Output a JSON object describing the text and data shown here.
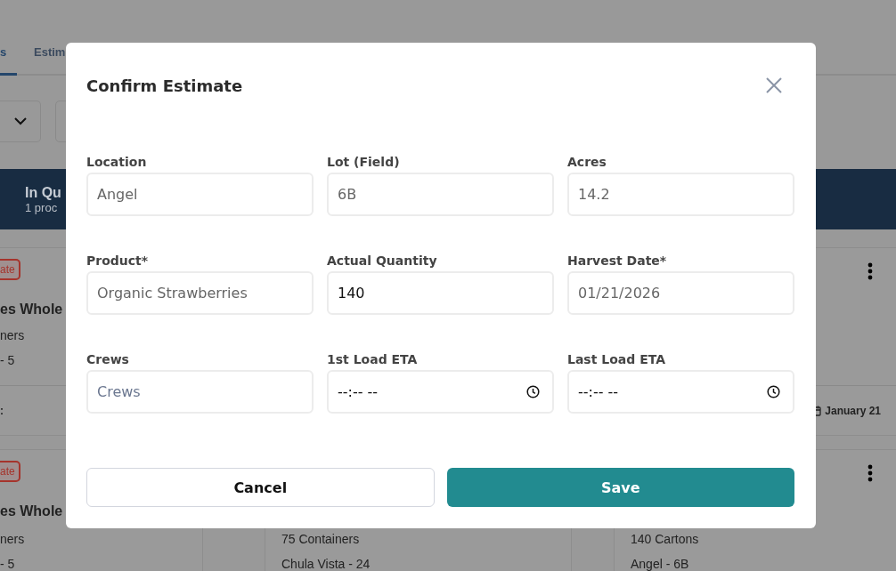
{
  "background": {
    "tabs": [
      {
        "label": "s",
        "selected": true
      },
      {
        "label": "Estim",
        "selected": false
      }
    ],
    "band": {
      "title": "In Qu",
      "subtitle": "1 proc"
    },
    "cards": [
      {
        "badge": "ate",
        "title": "es Whole",
        "lines": [
          "ners",
          "- 5"
        ],
        "footer": ":"
      },
      {
        "menu": true,
        "footer": "January 21",
        "footer_icon": true
      },
      {
        "badge": "ate",
        "title": "es Whole",
        "lines": [
          "ners",
          "- 5"
        ]
      },
      {
        "lines": [
          "75 Containers",
          "Chula Vista - 24"
        ]
      },
      {
        "lines": [
          "140 Cartons",
          "Angel - 6B"
        ],
        "menu": true
      }
    ]
  },
  "dialog": {
    "title": "Confirm Estimate",
    "fields": [
      {
        "label": "Location",
        "kind": "text",
        "value": "Angel",
        "disabled": true
      },
      {
        "label": "Lot (Field)",
        "kind": "text",
        "value": "6B",
        "disabled": true
      },
      {
        "label": "Acres",
        "kind": "text",
        "value": "14.2",
        "disabled": true
      },
      {
        "label": "Product*",
        "kind": "text",
        "value": "Organic Strawberries",
        "disabled": true
      },
      {
        "label": "Actual Quantity",
        "kind": "text",
        "value": "140",
        "disabled": false
      },
      {
        "label": "Harvest Date*",
        "kind": "text",
        "value": "01/21/2026",
        "disabled": true
      },
      {
        "label": "Crews",
        "kind": "text",
        "placeholder": "Crews",
        "disabled": false
      },
      {
        "label": "1st Load ETA",
        "kind": "time",
        "value": "--:-- --",
        "disabled": false
      },
      {
        "label": "Last Load ETA",
        "kind": "time",
        "value": "--:-- --",
        "disabled": false
      }
    ],
    "buttons": [
      {
        "label": "Cancel",
        "kind": "secondary"
      },
      {
        "label": "Save",
        "kind": "primary"
      }
    ]
  }
}
